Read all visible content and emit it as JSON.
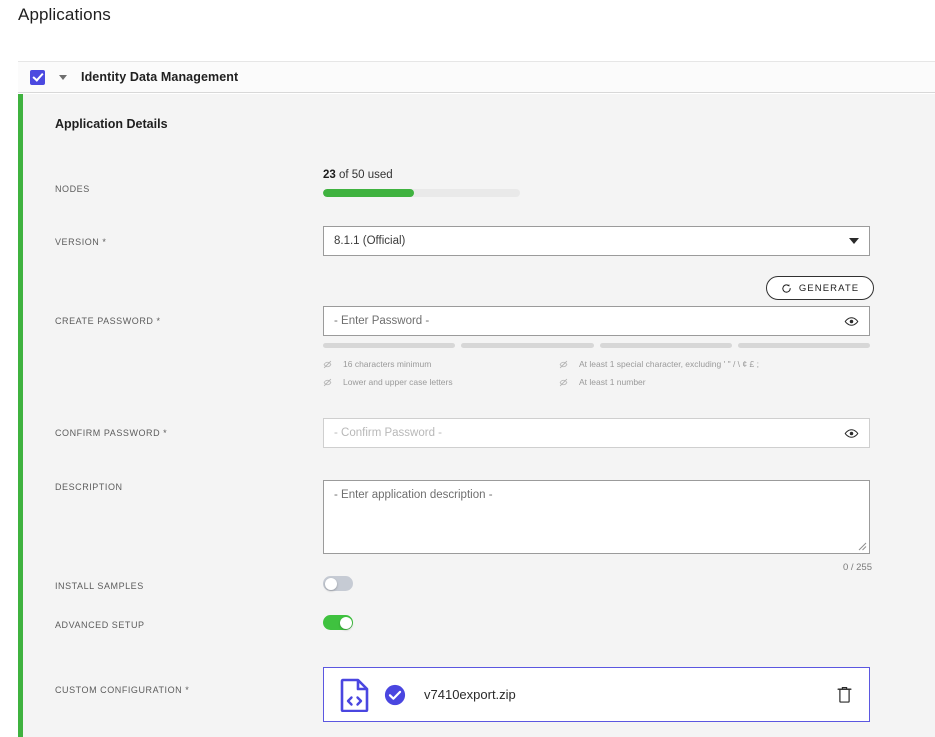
{
  "page": {
    "title": "Applications"
  },
  "app_header": {
    "name": "Identity Data Management",
    "checkbox_checked": true,
    "checkbox_color": "#4b49e0"
  },
  "panel": {
    "title": "Application Details",
    "accent_color": "#3fb23f"
  },
  "fields": {
    "nodes": {
      "label": "NODES",
      "used": "23",
      "rest": " of 50 used",
      "percent": 46
    },
    "version": {
      "label": "VERSION *",
      "value": "8.1.1 (Official)"
    },
    "generate": {
      "label": "GENERATE",
      "icon": "refresh-icon"
    },
    "create_password": {
      "label": "CREATE PASSWORD *",
      "placeholder": "- Enter Password -",
      "value": "",
      "strength_segments": 4,
      "strength_filled": 0
    },
    "password_rules": [
      {
        "text": "16 characters minimum",
        "met": false
      },
      {
        "text": "At least 1 special character, excluding ' \" / \\ ¢ £ ;",
        "met": false
      },
      {
        "text": "Lower and upper case letters",
        "met": false
      },
      {
        "text": "At least 1 number",
        "met": false
      }
    ],
    "confirm_password": {
      "label": "CONFIRM PASSWORD *",
      "placeholder": "- Confirm Password -",
      "value": ""
    },
    "description": {
      "label": "DESCRIPTION",
      "placeholder": "- Enter application description -",
      "value": "",
      "counter": "0 / 255"
    },
    "install_samples": {
      "label": "INSTALL SAMPLES",
      "on": false
    },
    "advanced_setup": {
      "label": "ADVANCED SETUP",
      "on": true
    },
    "custom_configuration": {
      "label": "CUSTOM CONFIGURATION *",
      "file_name": "v7410export.zip",
      "file_status": "uploaded",
      "accent_color": "#5b57e0"
    }
  }
}
